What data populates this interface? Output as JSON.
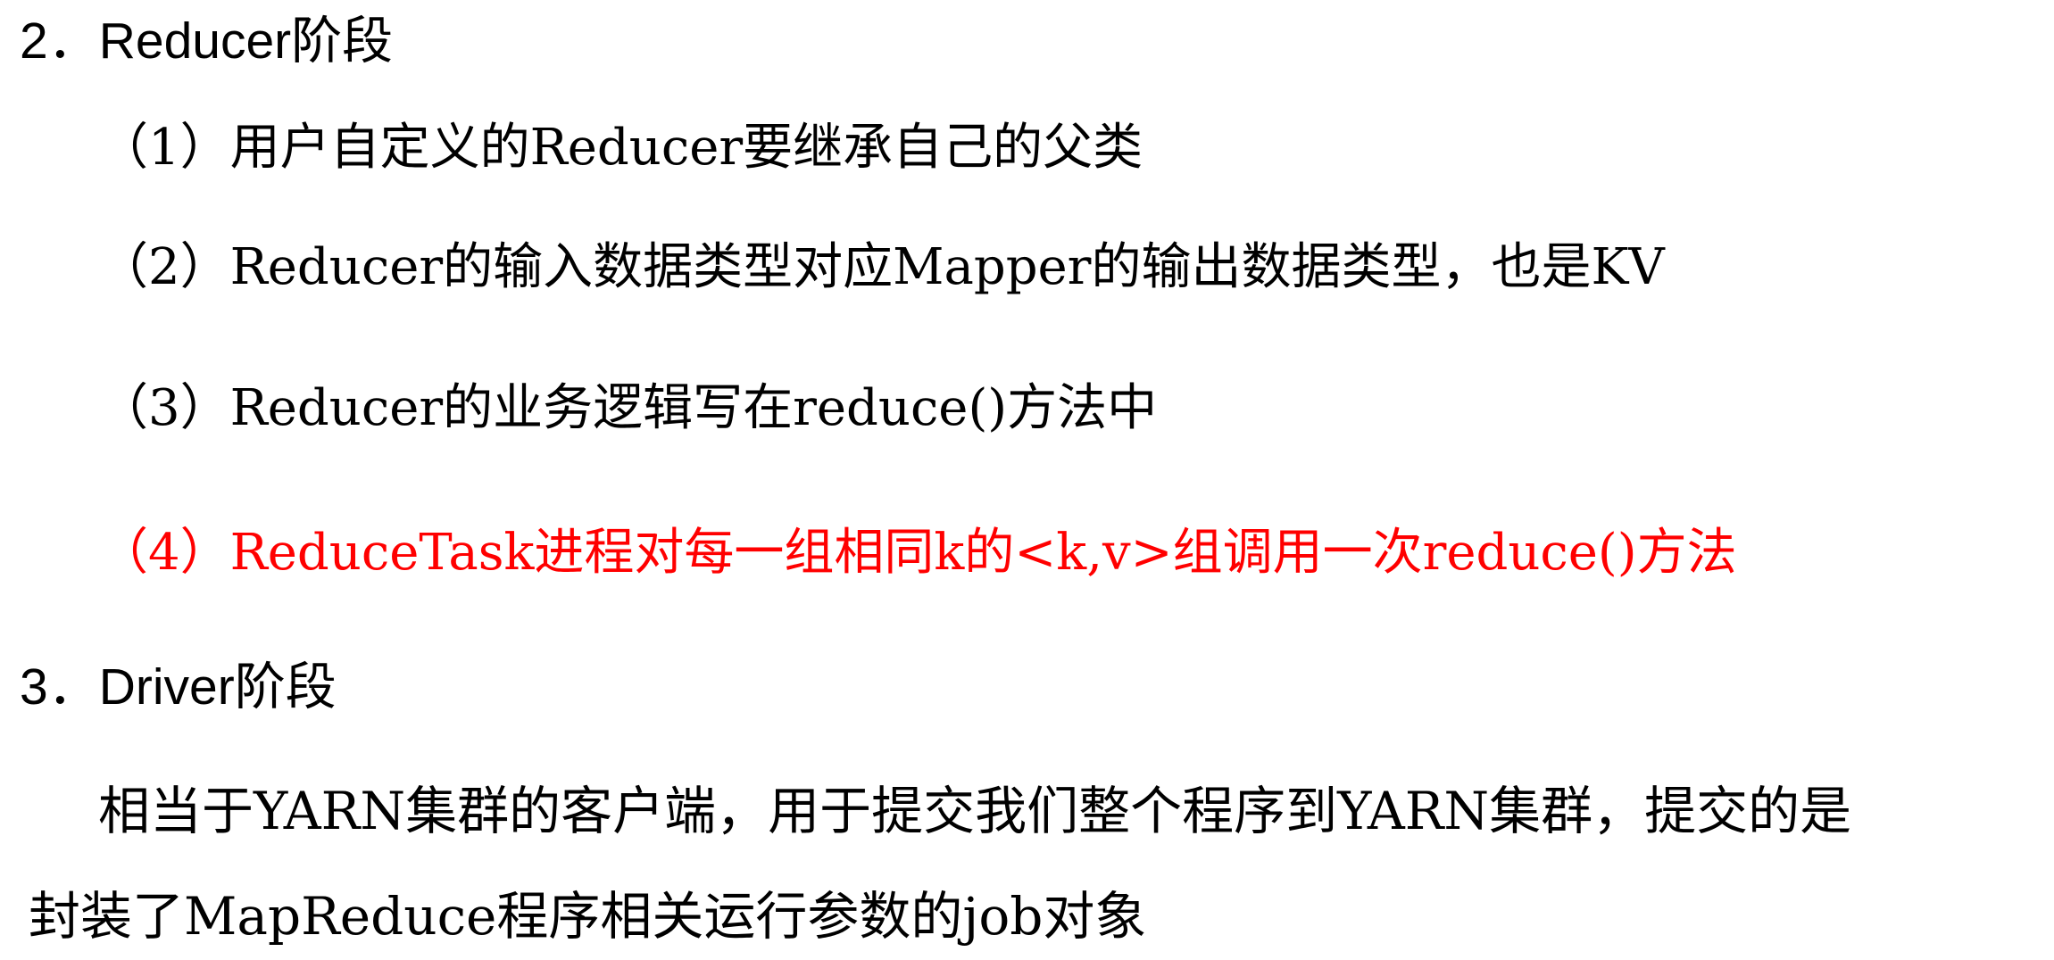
{
  "colors": {
    "text": "#000000",
    "highlight": "#ff0000",
    "background": "#ffffff"
  },
  "sections": {
    "reducer_heading": "2．Reducer阶段",
    "reducer_items": [
      "（1）用户自定义的Reducer要继承自己的父类",
      "（2）Reducer的输入数据类型对应Mapper的输出数据类型，也是KV",
      "（3）Reducer的业务逻辑写在reduce()方法中",
      "（4）ReduceTask进程对每一组相同k的<k,v>组调用一次reduce()方法"
    ],
    "driver_heading": "3．Driver阶段",
    "driver_paragraph_line1": "相当于YARN集群的客户端，用于提交我们整个程序到YARN集群，提交的是",
    "driver_paragraph_line2": "封装了MapReduce程序相关运行参数的job对象"
  }
}
